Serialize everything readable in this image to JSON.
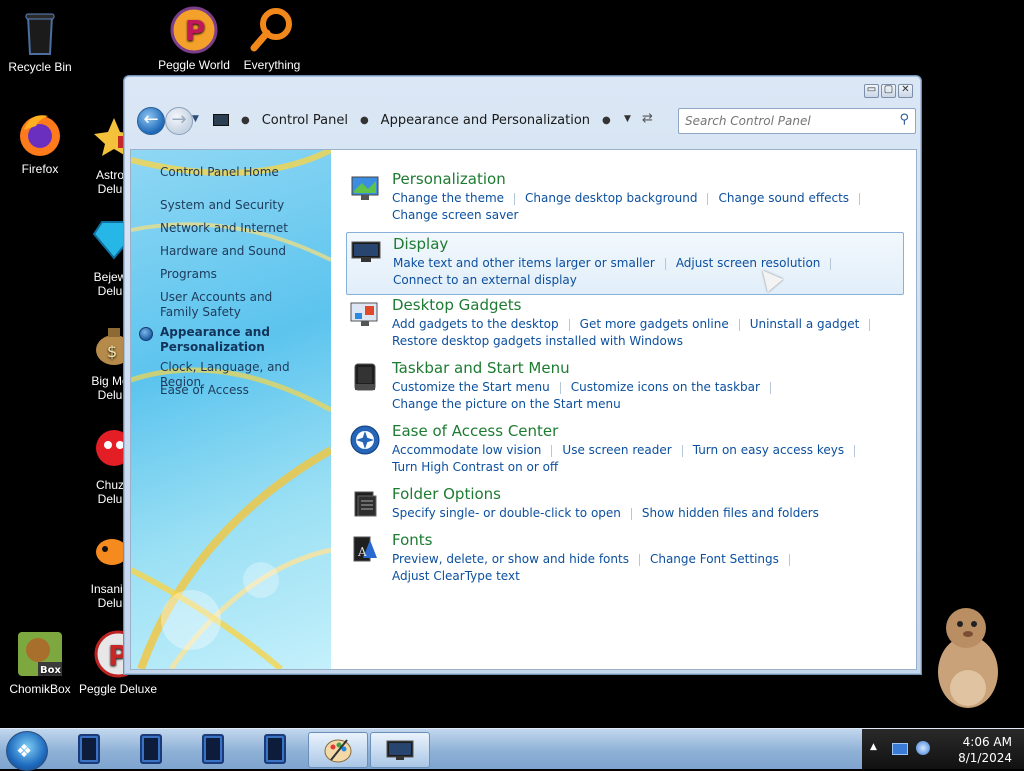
{
  "desktop": {
    "icons": [
      {
        "label": "Recycle Bin",
        "icon": "recycle-bin-icon"
      },
      {
        "label": "Peggle World",
        "icon": "peggle-icon"
      },
      {
        "label": "Everything",
        "icon": "magnifier-icon"
      },
      {
        "label": "Firefox",
        "icon": "firefox-icon"
      },
      {
        "label": "Astro",
        "label2": "Delu",
        "icon": "astro-icon"
      },
      {
        "label": "Bejew",
        "label2": "Delu",
        "icon": "gem-icon"
      },
      {
        "label": "Big Mo",
        "label2": "Delu",
        "icon": "money-bag-icon"
      },
      {
        "label": "Chuz",
        "label2": "Delu",
        "icon": "chuzzle-icon"
      },
      {
        "label": "Insaniq",
        "label2": "Delu",
        "icon": "fish-icon"
      },
      {
        "label": "ChomikBox",
        "icon": "chomikbox-icon"
      },
      {
        "label": "Peggle Deluxe",
        "icon": "peggle-deluxe-icon"
      }
    ]
  },
  "window": {
    "controls": {
      "minimize": "▭",
      "maximize": "▢",
      "close": "✕"
    },
    "breadcrumb": [
      "Control Panel",
      "Appearance and Personalization"
    ],
    "search": {
      "placeholder": "Search Control Panel"
    }
  },
  "sidebar": {
    "items": [
      {
        "label": "Control Panel Home",
        "active": false
      },
      {
        "label": "System and Security",
        "active": false
      },
      {
        "label": "Network and Internet",
        "active": false
      },
      {
        "label": "Hardware and Sound",
        "active": false
      },
      {
        "label": "Programs",
        "active": false
      },
      {
        "label": "User Accounts and Family Safety",
        "active": false
      },
      {
        "label": "Appearance and Personalization",
        "active": true
      },
      {
        "label": "Clock, Language, and Region",
        "active": false
      },
      {
        "label": "Ease of Access",
        "active": false
      }
    ]
  },
  "categories": [
    {
      "title": "Personalization",
      "icon": "personalization-icon",
      "links": [
        "Change the theme",
        "Change desktop background",
        "Change sound effects",
        "Change screen saver"
      ]
    },
    {
      "title": "Display",
      "icon": "display-icon",
      "highlighted": true,
      "links": [
        "Make text and other items larger or smaller",
        "Adjust screen resolution",
        "Connect to an external display"
      ]
    },
    {
      "title": "Desktop Gadgets",
      "icon": "gadgets-icon",
      "links": [
        "Add gadgets to the desktop",
        "Get more gadgets online",
        "Uninstall a gadget",
        "Restore desktop gadgets installed with Windows"
      ]
    },
    {
      "title": "Taskbar and Start Menu",
      "icon": "taskbar-icon",
      "links": [
        "Customize the Start menu",
        "Customize icons on the taskbar",
        "Change the picture on the Start menu"
      ]
    },
    {
      "title": "Ease of Access Center",
      "icon": "ease-of-access-icon",
      "links": [
        "Accommodate low vision",
        "Use screen reader",
        "Turn on easy access keys",
        "Turn High Contrast on or off"
      ]
    },
    {
      "title": "Folder Options",
      "icon": "folder-options-icon",
      "links": [
        "Specify single- or double-click to open",
        "Show hidden files and folders"
      ]
    },
    {
      "title": "Fonts",
      "icon": "fonts-icon",
      "links": [
        "Preview, delete, or show and hide fonts",
        "Change Font Settings",
        "Adjust ClearType text"
      ]
    }
  ],
  "taskbar": {
    "time": "4:06 AM",
    "date": "8/1/2024"
  },
  "colors": {
    "category_title": "#1e7b32",
    "link": "#0b4f9e",
    "sidebar_text": "#1e3a5a"
  }
}
